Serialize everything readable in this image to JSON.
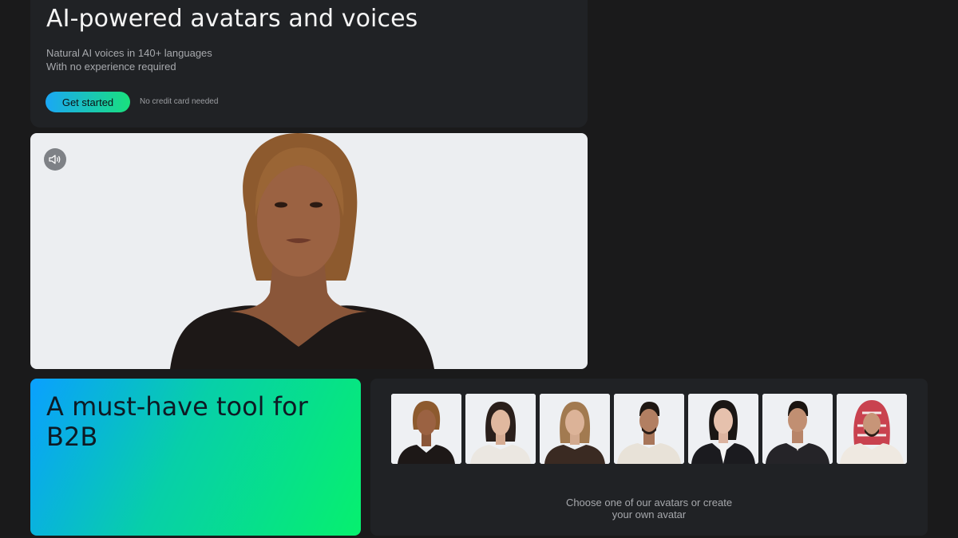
{
  "hero": {
    "title": "AI-powered avatars and voices",
    "subtitle_line1": "Natural AI voices in 140+ languages",
    "subtitle_line2": "With no experience required",
    "cta_label": "Get started",
    "cta_note": "No credit card needed"
  },
  "video": {
    "mute_icon": "speaker-icon"
  },
  "b2b": {
    "title": "A must-have tool for B2B"
  },
  "avatars": {
    "caption_line1": "Choose one of our avatars or create",
    "caption_line2": "your own avatar",
    "thumbnails": [
      {
        "name": "avatar-1"
      },
      {
        "name": "avatar-2"
      },
      {
        "name": "avatar-3"
      },
      {
        "name": "avatar-4"
      },
      {
        "name": "avatar-5"
      },
      {
        "name": "avatar-6"
      },
      {
        "name": "avatar-7"
      }
    ]
  },
  "colors": {
    "background": "#1a1a1b",
    "card": "#202225",
    "accent_start": "#1aa7f5",
    "accent_end": "#19e07d"
  }
}
